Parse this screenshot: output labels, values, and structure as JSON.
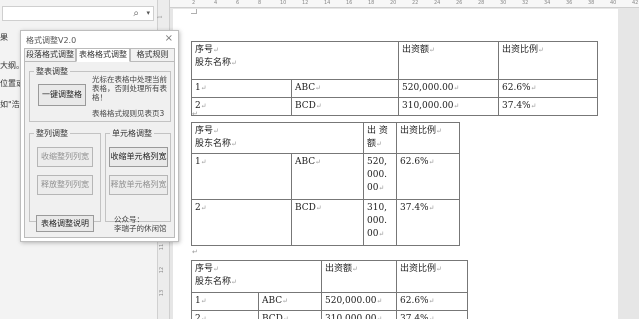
{
  "nav": {
    "search_placeholder": "",
    "text_lines": [
      "果",
      "大纲。",
      "位置或",
      "如\"浩瀚"
    ]
  },
  "hruler": [
    "2",
    "4",
    "6",
    "8",
    "10",
    "12",
    "14",
    "16",
    "18",
    "20",
    "22",
    "24",
    "26",
    "28",
    "30",
    "32",
    "34",
    "36",
    "38",
    "40",
    "42"
  ],
  "vruler": [
    "1",
    "2",
    "3",
    "4",
    "5",
    "6",
    "7",
    "8",
    "9",
    "10",
    "11",
    "12",
    "13"
  ],
  "dialog": {
    "title": "格式调整V2.0",
    "close": "×",
    "tabs": [
      "段落格式调整",
      "表格格式调整",
      "格式规则"
    ],
    "active_tab": 1,
    "table_adjust": {
      "legend": "整表调整",
      "one_click_button": "一键调整格",
      "hint": "光标在表格中处理当前表格，否则处理所有表格！",
      "rules_note": "表格格式规则见表页3"
    },
    "column_adjust": {
      "legend": "整列调整",
      "shrink_button": "收缩整列列宽",
      "release_button": "释放整列列宽"
    },
    "cell_adjust": {
      "legend": "单元格调整",
      "shrink_button": "收缩单元格列宽",
      "release_button": "释放单元格列宽"
    },
    "footer": {
      "help_button": "表格调整说明",
      "public_account": "公众号：",
      "author": "李瑞子的休闲馆"
    }
  },
  "doc": {
    "pilcrow": "↵",
    "headers": {
      "seq": "序号",
      "name": "股东名称",
      "amount": "出资额",
      "ratio": "出资比例",
      "amount_wrapped": [
        "出 资",
        "额"
      ]
    },
    "rows": [
      {
        "seq": "1",
        "name": "ABC",
        "amount": "520,000.00",
        "amount_wrapped": [
          "520,",
          "000.",
          "00"
        ],
        "ratio": "62.6%"
      },
      {
        "seq": "2",
        "name": "BCD",
        "amount": "310,000.00",
        "amount_wrapped": [
          "310,",
          "000.",
          "00"
        ],
        "ratio": "37.4%"
      }
    ]
  }
}
